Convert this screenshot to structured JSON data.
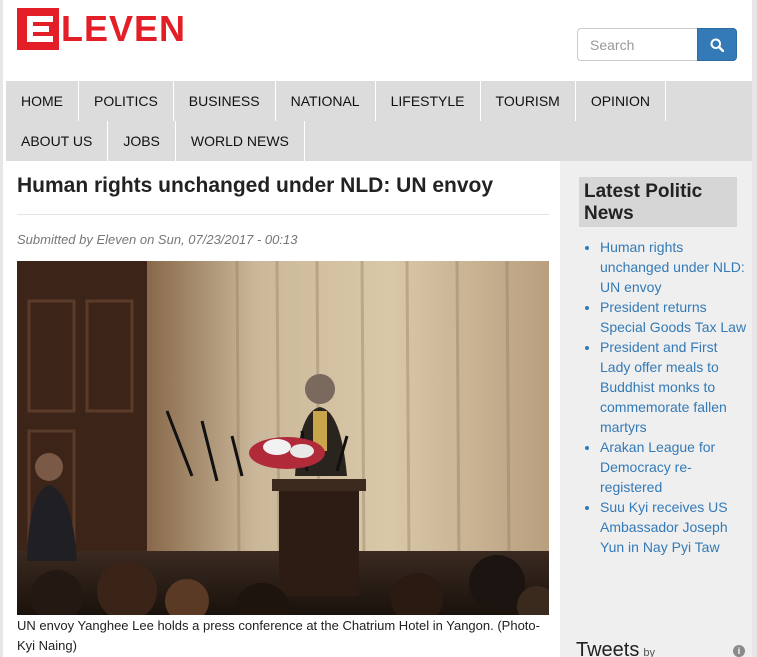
{
  "brand": {
    "logo_text": "LEVEN",
    "accent": "#e41e26"
  },
  "search": {
    "placeholder": "Search",
    "icon": "search-icon"
  },
  "nav": {
    "row1": [
      "HOME",
      "POLITICS",
      "BUSINESS",
      "NATIONAL",
      "LIFESTYLE",
      "TOURISM",
      "OPINION"
    ],
    "row2": [
      "ABOUT US",
      "JOBS",
      "WORLD NEWS"
    ]
  },
  "article": {
    "title": "Human rights unchanged under NLD: UN envoy",
    "submitted": "Submitted by Eleven on Sun, 07/23/2017 - 00:13",
    "caption": "UN envoy Yanghee Lee holds a press conference at the Chatrium Hotel in Yangon. (Photo-Kyi Naing)"
  },
  "sidebar": {
    "heading": "Latest Politic News",
    "items": [
      "Human rights unchanged under NLD: UN envoy",
      "President returns Special Goods Tax Law",
      "President and First Lady offer meals to Buddhist monks to commemorate fallen martyrs",
      "Arakan League for Democracy re-registered",
      "Suu Kyi receives US Ambassador Joseph Yun in Nay Pyi Taw"
    ],
    "link_color": "#337ab7"
  },
  "tweets": {
    "label": "Tweets",
    "by": "by",
    "info_icon": "info-icon"
  }
}
